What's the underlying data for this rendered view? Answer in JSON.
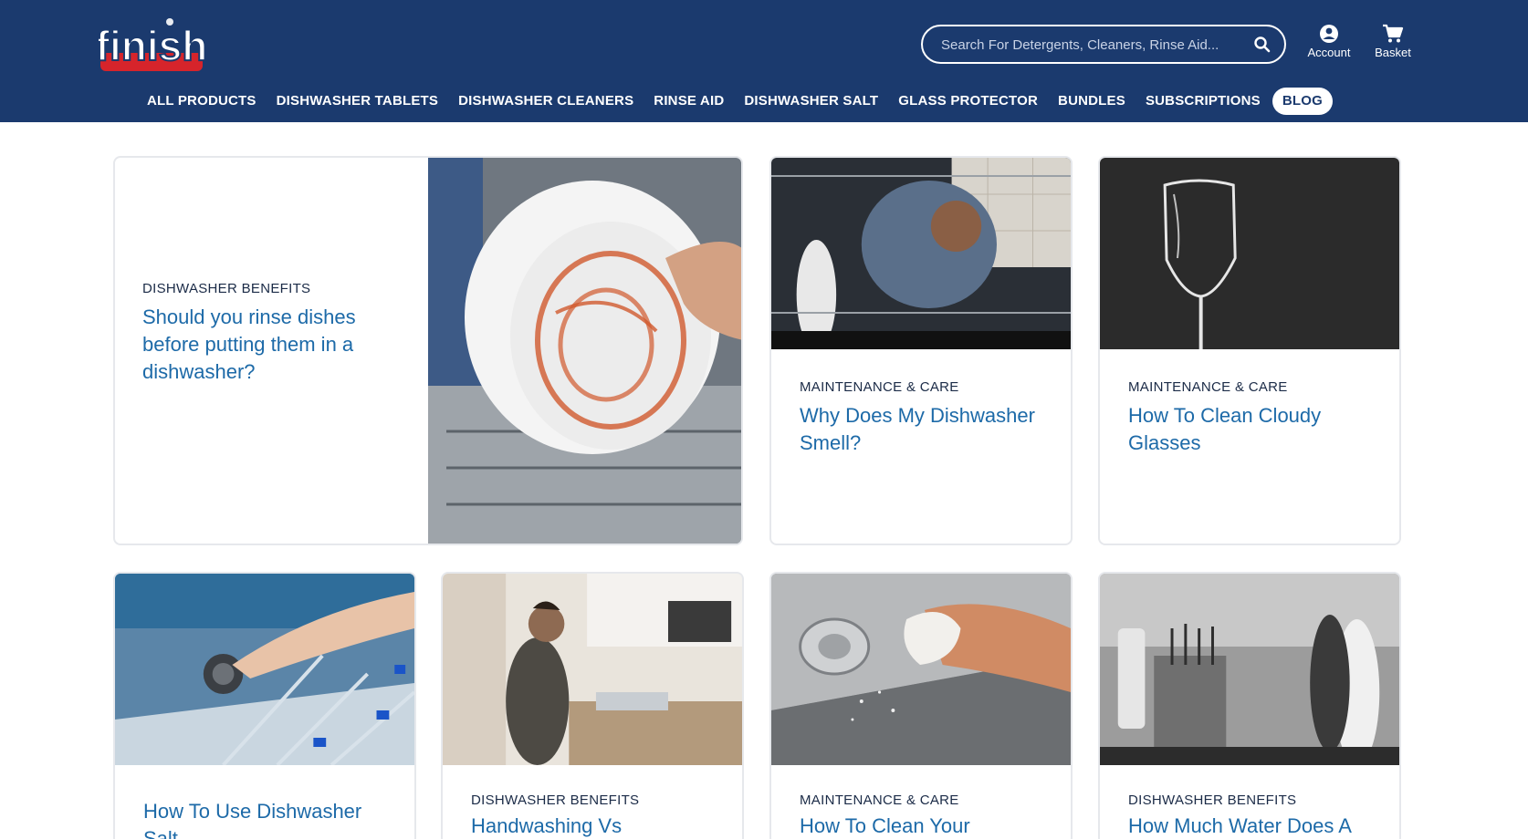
{
  "header": {
    "logo_text": "finish",
    "search": {
      "placeholder": "Search For Detergents, Cleaners, Rinse Aid..."
    },
    "account_label": "Account",
    "basket_label": "Basket"
  },
  "nav": {
    "items": [
      {
        "label": "ALL PRODUCTS"
      },
      {
        "label": "DISHWASHER TABLETS"
      },
      {
        "label": "DISHWASHER CLEANERS"
      },
      {
        "label": "RINSE AID"
      },
      {
        "label": "DISHWASHER SALT"
      },
      {
        "label": "GLASS PROTECTOR"
      },
      {
        "label": "BUNDLES"
      },
      {
        "label": "SUBSCRIPTIONS"
      },
      {
        "label": "BLOG"
      }
    ],
    "active": "BLOG"
  },
  "articles": [
    {
      "category": "DISHWASHER BENEFITS",
      "title": "Should you rinse dishes before putting them in a dishwasher?",
      "image": "dirty-plate-photo"
    },
    {
      "category": "MAINTENANCE & CARE",
      "title": "Why Does My Dishwasher Smell?",
      "image": "man-looking-into-dishwasher-photo"
    },
    {
      "category": "MAINTENANCE & CARE",
      "title": "How To Clean Cloudy Glasses",
      "image": "wine-glass-photo"
    },
    {
      "category": "",
      "title": "How To Use Dishwasher Salt",
      "image": "dishwasher-salt-cap-photo"
    },
    {
      "category": "DISHWASHER BENEFITS",
      "title": "Handwashing Vs",
      "image": "man-washing-dishes-photo"
    },
    {
      "category": "MAINTENANCE & CARE",
      "title": "How To Clean Your",
      "image": "cleaning-dishwasher-photo"
    },
    {
      "category": "DISHWASHER BENEFITS",
      "title": "How Much Water Does A",
      "image": "dishwasher-spray-photo"
    }
  ],
  "colors": {
    "header_bg": "#1b3a6e",
    "title_blue": "#1d6aa8",
    "logo_red": "#d6242b"
  }
}
